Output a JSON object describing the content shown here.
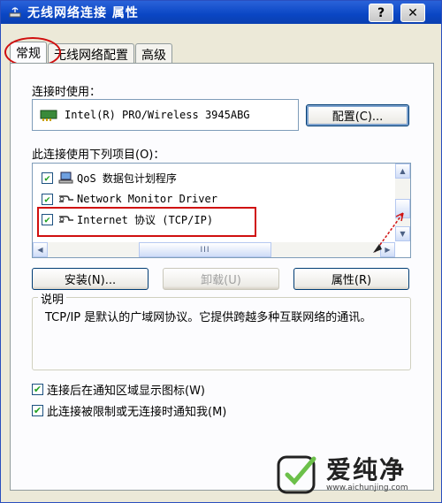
{
  "window": {
    "title": "无线网络连接 属性",
    "help_btn": "?",
    "close_btn": "✕"
  },
  "tabs": [
    {
      "label": "常规"
    },
    {
      "label": "无线网络配置"
    },
    {
      "label": "高级"
    }
  ],
  "general": {
    "connect_using_label": "连接时使用：",
    "adapter_name": "Intel(R) PRO/Wireless 3945ABG",
    "configure_button": "配置(C)...",
    "items_label": "此连接使用下列项目(O)：",
    "items": [
      {
        "label": "QoS 数据包计划程序",
        "checked": true,
        "icon": "qos-icon"
      },
      {
        "label": "Network Monitor Driver",
        "checked": true,
        "icon": "protocol-icon"
      },
      {
        "label": "Internet 协议 (TCP/IP)",
        "checked": true,
        "icon": "protocol-icon"
      }
    ],
    "check_mark": "✔",
    "hscroll_grip": "III",
    "install_button": "安装(N)...",
    "uninstall_button": "卸载(U)",
    "properties_button": "属性(R)",
    "description_legend": "说明",
    "description_text": "TCP/IP 是默认的广域网协议。它提供跨越多种互联网络的通讯。",
    "show_icon_label": "连接后在通知区域显示图标(W)",
    "show_icon_checked": true,
    "notify_label": "此连接被限制或无连接时通知我(M)",
    "notify_checked": true
  },
  "watermark": {
    "brand": "爱纯净",
    "url": "www.aichunjing.com"
  },
  "colors": {
    "titlebar": "#0a46c4",
    "annotation_red": "#d01010",
    "watermark_green": "#6cc04a"
  }
}
